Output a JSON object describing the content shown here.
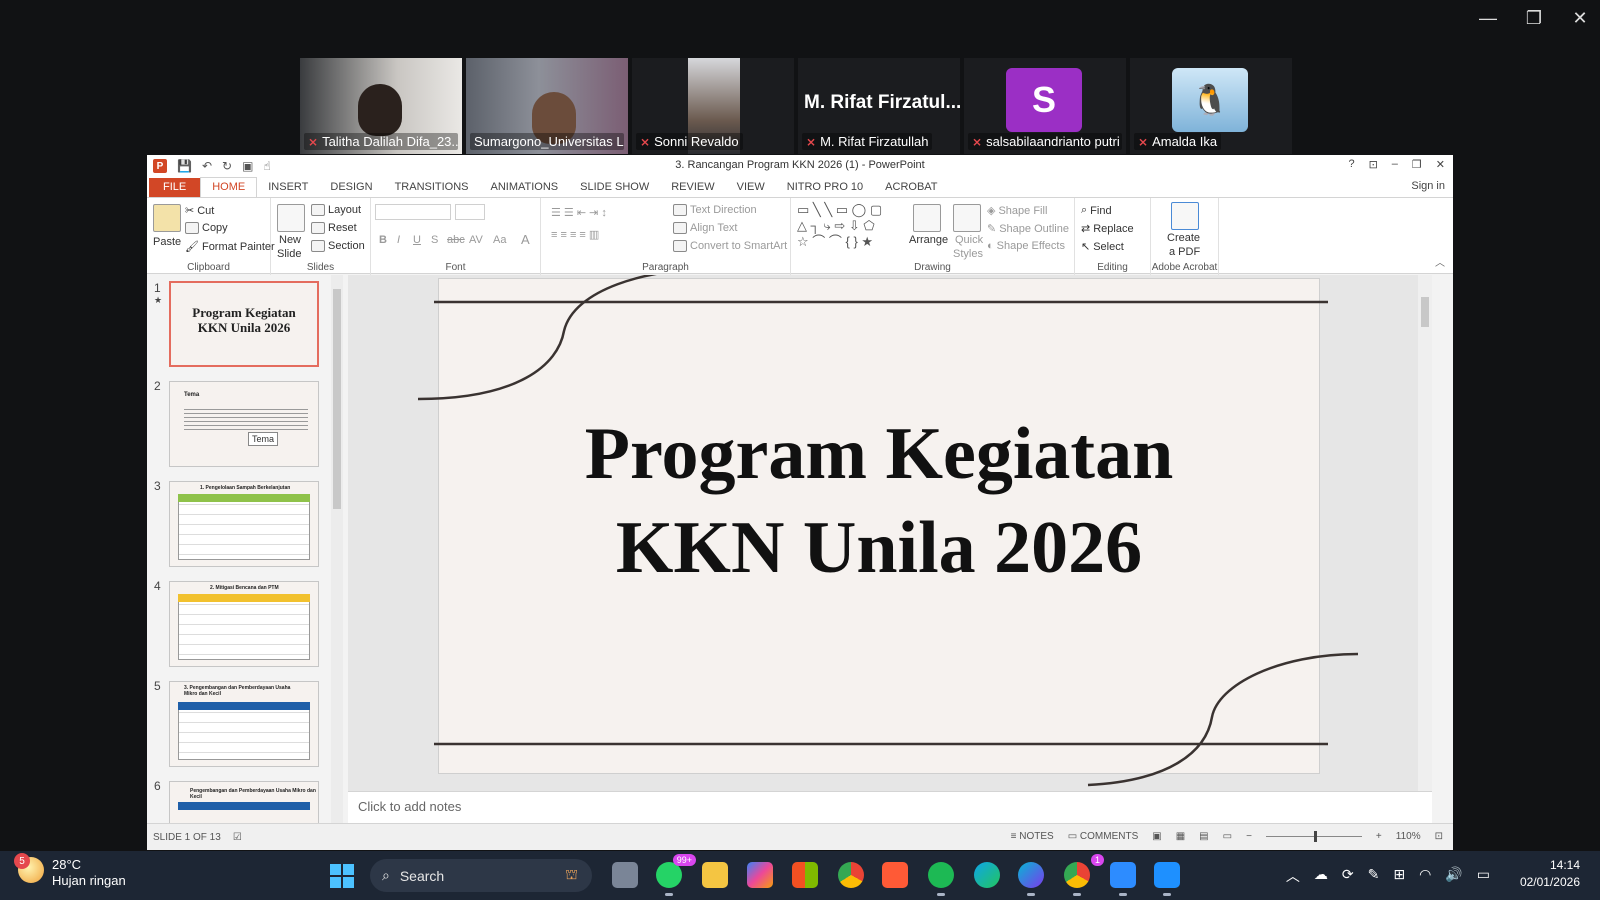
{
  "zoom": {
    "window_controls": {
      "minimize": "—",
      "restore": "❐",
      "close": "✕"
    },
    "participants": [
      {
        "name": "Talitha Dalilah Difa_23...",
        "muted": true,
        "type": "video"
      },
      {
        "name": "Sumargono_Universitas L...",
        "muted": false,
        "type": "video",
        "active_speaker": true
      },
      {
        "name": "Sonni Revaldo",
        "muted": true,
        "type": "video"
      },
      {
        "name": "M. Rifat Firzatullah",
        "muted": true,
        "type": "name",
        "display": "M. Rifat  Firzatul..."
      },
      {
        "name": "salsabilaandrianto putri",
        "muted": true,
        "type": "avatar",
        "avatar_letter": "S",
        "avatar_color": "#9b2fc5"
      },
      {
        "name": "Amalda Ika",
        "muted": true,
        "type": "avatar-image"
      }
    ]
  },
  "powerpoint": {
    "title": "3. Rancangan Program KKN 2026 (1) - PowerPoint",
    "app_icon": "P",
    "window_buttons": {
      "help": "?",
      "ribbon_display": "⊡",
      "minimize": "–",
      "restore": "❐",
      "close": "✕"
    },
    "sign_in": "Sign in",
    "tabs": [
      "FILE",
      "HOME",
      "INSERT",
      "DESIGN",
      "TRANSITIONS",
      "ANIMATIONS",
      "SLIDE SHOW",
      "REVIEW",
      "VIEW",
      "NITRO PRO 10",
      "ACROBAT"
    ],
    "active_tab": "HOME",
    "ribbon": {
      "clipboard": {
        "label": "Clipboard",
        "paste": "Paste",
        "cut": "Cut",
        "copy": "Copy",
        "format_painter": "Format Painter"
      },
      "slides": {
        "label": "Slides",
        "new_slide_1": "New",
        "new_slide_2": "Slide",
        "layout": "Layout",
        "reset": "Reset",
        "section": "Section"
      },
      "font": {
        "label": "Font",
        "bold": "B",
        "italic": "I",
        "underline": "U",
        "shadow": "S",
        "strike": "abc",
        "spacing": "AV",
        "case": "Aa",
        "color": "A"
      },
      "paragraph": {
        "label": "Paragraph",
        "text_direction": "Text Direction",
        "align_text": "Align Text",
        "smartart": "Convert to SmartArt"
      },
      "drawing": {
        "label": "Drawing",
        "arrange": "Arrange",
        "quick_styles_1": "Quick",
        "quick_styles_2": "Styles",
        "shape_fill": "Shape Fill",
        "shape_outline": "Shape Outline",
        "shape_effects": "Shape Effects"
      },
      "editing": {
        "label": "Editing",
        "find": "Find",
        "replace": "Replace",
        "select": "Select"
      },
      "acrobat": {
        "label": "Adobe Acrobat",
        "create_pdf_1": "Create",
        "create_pdf_2": "a PDF"
      }
    },
    "thumbnails": [
      {
        "num": "1",
        "title_line1": "Program Kegiatan",
        "title_line2": "KKN Unila 2026",
        "selected": true
      },
      {
        "num": "2",
        "heading": "Tema",
        "tooltip": "Tema"
      },
      {
        "num": "3",
        "heading": "1. Pengelolaan Sampah Berkelanjutan"
      },
      {
        "num": "4",
        "heading": "2. Mitigasi Bencana dan PTM"
      },
      {
        "num": "5",
        "heading": "3. Pengembangan dan Pemberdayaan Usaha Mikro dan Kecil"
      },
      {
        "num": "6",
        "heading": "Pengembangan dan Pemberdayaan Usaha Mikro dan Kecil"
      }
    ],
    "slide": {
      "title_line1": "Program Kegiatan",
      "title_line2": "KKN Unila 2026"
    },
    "notes_placeholder": "Click to add notes",
    "status": {
      "slide_info": "SLIDE 1 OF 13",
      "notes": "NOTES",
      "comments": "COMMENTS",
      "zoom": "110%"
    }
  },
  "taskbar": {
    "weather_temp": "28°C",
    "weather_desc": "Hujan ringan",
    "weather_badge": "5",
    "search": "Search",
    "whatsapp_badge": "99+",
    "chrome_badge": "1",
    "time": "14:14",
    "date": "02/01/2026"
  }
}
